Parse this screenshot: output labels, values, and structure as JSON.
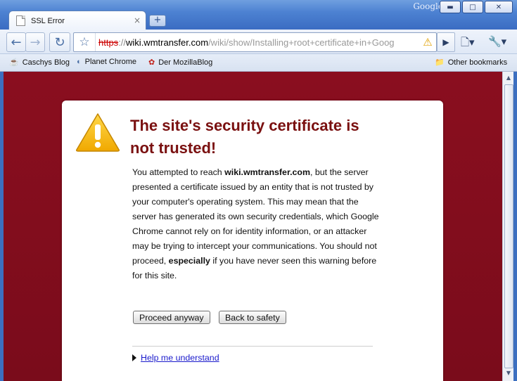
{
  "window": {
    "brand": "Google",
    "minimize_glyph": "▬",
    "maximize_glyph": "□",
    "close_glyph": "✕"
  },
  "tab": {
    "title": "SSL Error",
    "close_glyph": "×",
    "new_tab_glyph": "+"
  },
  "toolbar": {
    "back_glyph": "←",
    "forward_glyph": "→",
    "reload_glyph": "↻",
    "star_glyph": "☆",
    "url_scheme": "https",
    "url_separator": "://",
    "url_host": "wiki.wmtransfer.com",
    "url_path": "/wiki/show/Installing+root+certificate+in+Goog",
    "warning_glyph": "⚠",
    "go_glyph": "▶",
    "page_menu_glyph": "🗋▾",
    "wrench_menu_glyph": "🔧▾"
  },
  "bookmarks": {
    "items": [
      {
        "label": "Caschys Blog",
        "icon": "coffee-cup-icon",
        "glyph": "☕"
      },
      {
        "label": "Planet Chrome",
        "icon": "chrome-planet-icon",
        "glyph": "◐"
      },
      {
        "label": "Der MozillaBlog",
        "icon": "firefox-icon",
        "glyph": "✿"
      }
    ],
    "other_label": "Other bookmarks",
    "other_glyph": "📁"
  },
  "page": {
    "background_color": "#7d0c1c",
    "heading": "The site's security certificate is not trusted!",
    "body_intro": "You attempted to reach ",
    "body_host": "wiki.wmtransfer.com",
    "body_main": ", but the server presented a certificate issued by an entity that is not trusted by your computer's operating system. This may mean that the server has generated its own security credentials, which Google Chrome cannot rely on for identity information, or an attacker may be trying to intercept your communications. You should not proceed, ",
    "body_emphasis": "especially",
    "body_end": " if you have never seen this warning before for this site.",
    "proceed_label": "Proceed anyway",
    "back_label": "Back to safety",
    "help_label": "Help me understand"
  },
  "scrollbar": {
    "up_glyph": "▲",
    "down_glyph": "▼"
  }
}
